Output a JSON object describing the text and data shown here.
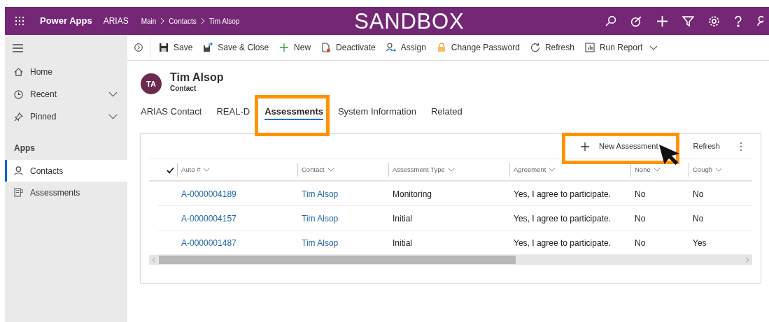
{
  "top_bar": {
    "app_name": "Power Apps",
    "environment": "ARIAS",
    "breadcrumbs": [
      "Main",
      "Contacts",
      "Tim Alsop"
    ],
    "banner": "SANDBOX"
  },
  "sidebar": {
    "items": [
      {
        "label": "Home",
        "expandable": false
      },
      {
        "label": "Recent",
        "expandable": true
      },
      {
        "label": "Pinned",
        "expandable": true
      }
    ],
    "section": "Apps",
    "apps": [
      {
        "label": "Contacts",
        "selected": true
      },
      {
        "label": "Assessments",
        "selected": false
      }
    ]
  },
  "toolbar": [
    {
      "label": "Save",
      "dropdown": false
    },
    {
      "label": "Save & Close",
      "dropdown": false
    },
    {
      "label": "New",
      "dropdown": false
    },
    {
      "label": "Deactivate",
      "dropdown": false
    },
    {
      "label": "Assign",
      "dropdown": false
    },
    {
      "label": "Change Password",
      "dropdown": false
    },
    {
      "label": "Refresh",
      "dropdown": false
    },
    {
      "label": "Run Report",
      "dropdown": true
    }
  ],
  "record": {
    "initials": "TA",
    "name": "Tim Alsop",
    "type": "Contact"
  },
  "tabs": [
    {
      "label": "ARIAS Contact",
      "selected": false
    },
    {
      "label": "REAL-D",
      "selected": false
    },
    {
      "label": "Assessments",
      "selected": true
    },
    {
      "label": "System Information",
      "selected": false
    },
    {
      "label": "Related",
      "selected": false
    }
  ],
  "grid": {
    "commands": [
      {
        "label": "New Assessment"
      },
      {
        "label": "Refresh"
      }
    ],
    "columns": [
      "Auto #",
      "Contact",
      "Assessment Type",
      "Agreement",
      "None",
      "Cough"
    ],
    "rows": [
      {
        "cells": [
          "A-0000004189",
          "Tim Alsop",
          "Monitoring",
          "Yes, I agree to participate.",
          "No",
          "No"
        ]
      },
      {
        "cells": [
          "A-0000004157",
          "Tim Alsop",
          "Initial",
          "Yes, I agree to participate.",
          "No",
          "No"
        ]
      },
      {
        "cells": [
          "A-0000001487",
          "Tim Alsop",
          "Initial",
          "Yes, I agree to participate.",
          "No",
          "Yes"
        ]
      }
    ]
  }
}
